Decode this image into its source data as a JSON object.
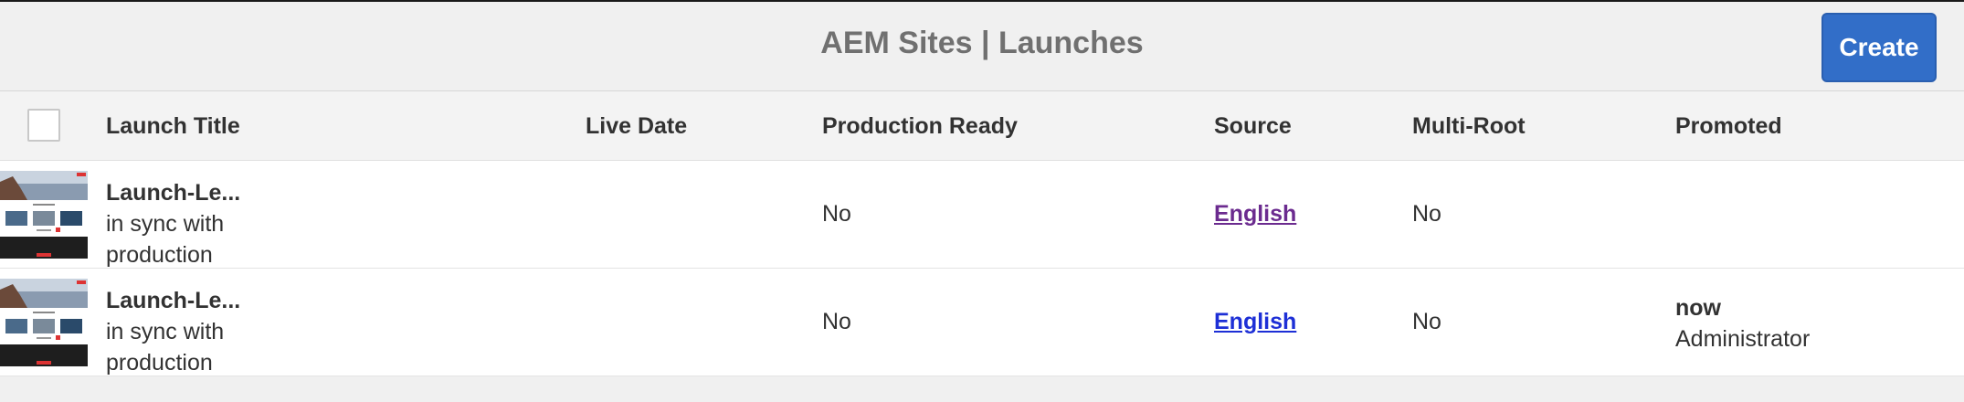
{
  "header": {
    "title": "AEM Sites | Launches",
    "create_label": "Create"
  },
  "columns": {
    "launch_title": "Launch Title",
    "live_date": "Live Date",
    "production_ready": "Production Ready",
    "source": "Source",
    "multi_root": "Multi-Root",
    "promoted": "Promoted"
  },
  "rows": [
    {
      "name": "Launch-Le...",
      "sub1": "in sync with",
      "sub2": "production",
      "live_date": "",
      "production_ready": "No",
      "source": "English",
      "multi_root": "No",
      "promoted_when": "",
      "promoted_by": ""
    },
    {
      "name": "Launch-Le...",
      "sub1": "in sync with",
      "sub2": "production",
      "live_date": "",
      "production_ready": "No",
      "source": "English",
      "multi_root": "No",
      "promoted_when": "now",
      "promoted_by": "Administrator"
    }
  ],
  "colors": {
    "accent": "#326ec8",
    "visited_link": "#6b2b8f",
    "link": "#1d2fd6"
  }
}
